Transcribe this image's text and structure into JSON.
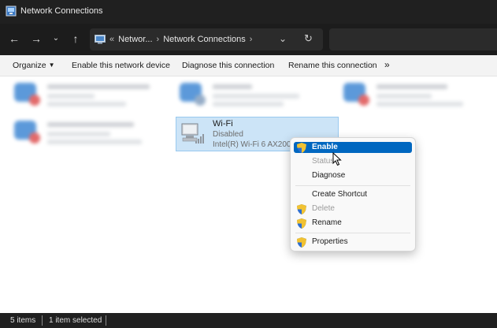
{
  "window": {
    "title": "Network Connections"
  },
  "address": {
    "overflow": "«",
    "crumbs": [
      "Networ...",
      "Network Connections"
    ],
    "dropdown_icon": "chevron-down-icon",
    "refresh_icon": "refresh-icon"
  },
  "commands": {
    "organize": "Organize",
    "enable": "Enable this network device",
    "diagnose": "Diagnose this connection",
    "rename": "Rename this connection",
    "more": "»"
  },
  "selected_item": {
    "name": "Wi-Fi",
    "status": "Disabled",
    "adapter": "Intel(R) Wi-Fi 6 AX200"
  },
  "context_menu": {
    "items": [
      {
        "label": "Enable",
        "enabled": true,
        "shield": true,
        "highlighted": true
      },
      {
        "label": "Status",
        "enabled": false,
        "shield": false
      },
      {
        "label": "Diagnose",
        "enabled": true,
        "shield": false
      },
      {
        "label": "Create Shortcut",
        "enabled": true,
        "shield": false
      },
      {
        "label": "Delete",
        "enabled": false,
        "shield": true
      },
      {
        "label": "Rename",
        "enabled": true,
        "shield": true
      },
      {
        "label": "Properties",
        "enabled": true,
        "shield": true
      }
    ]
  },
  "status_bar": {
    "item_count": "5 items",
    "selection": "1 item selected"
  },
  "colors": {
    "accent": "#0067c0",
    "selection_bg": "#cce4f7",
    "titlebar": "#202020"
  }
}
